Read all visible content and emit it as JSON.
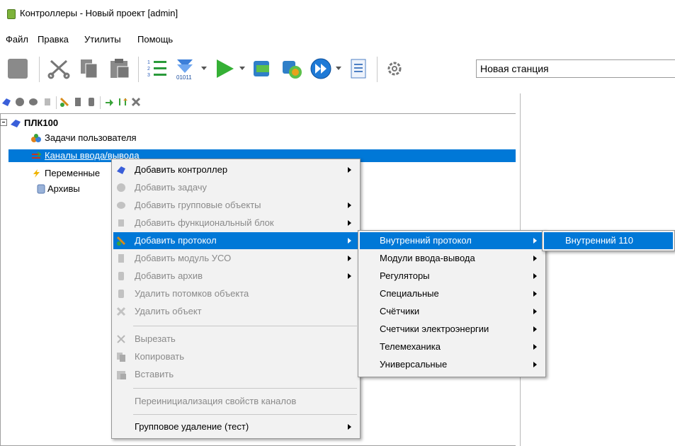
{
  "window": {
    "title": "Контроллеры - Новый проект [admin]"
  },
  "menubar": [
    "Файл",
    "Правка",
    "Утилиты",
    "Помощь"
  ],
  "toolbar": {
    "station_value": "Новая станция"
  },
  "tree": {
    "root": "ПЛК100",
    "children": [
      "Задачи пользователя",
      "Каналы ввода/вывода",
      "Переменные",
      "Архивы"
    ]
  },
  "context_menu": [
    {
      "label": "Добавить контроллер",
      "icon": "controller-icon",
      "enabled": true,
      "submenu": true
    },
    {
      "label": "Добавить задачу",
      "icon": "task-icon",
      "enabled": false,
      "submenu": false
    },
    {
      "label": "Добавить групповые объекты",
      "icon": "group-objects-icon",
      "enabled": false,
      "submenu": true
    },
    {
      "label": "Добавить функциональный блок",
      "icon": "function-block-icon",
      "enabled": false,
      "submenu": true
    },
    {
      "label": "Добавить протокол",
      "icon": "protocol-icon",
      "enabled": true,
      "submenu": true,
      "highlighted": true
    },
    {
      "label": "Добавить модуль УСО",
      "icon": "io-module-icon",
      "enabled": false,
      "submenu": true
    },
    {
      "label": "Добавить архив",
      "icon": "archive-icon",
      "enabled": false,
      "submenu": true
    },
    {
      "label": "Удалить потомков объекта",
      "icon": "delete-children-icon",
      "enabled": false,
      "submenu": false
    },
    {
      "label": "Удалить объект",
      "icon": "delete-icon",
      "enabled": false,
      "submenu": false
    },
    {
      "label": "Вырезать",
      "icon": "cut-icon",
      "enabled": false,
      "submenu": false
    },
    {
      "label": "Копировать",
      "icon": "copy-icon",
      "enabled": false,
      "submenu": false
    },
    {
      "label": "Вставить",
      "icon": "paste-icon",
      "enabled": false,
      "submenu": false
    },
    {
      "label": "Переинициализация свойств каналов",
      "icon": "",
      "enabled": false,
      "submenu": false
    },
    {
      "label": "Групповое удаление (тест)",
      "icon": "",
      "enabled": true,
      "submenu": true
    }
  ],
  "protocol_submenu": [
    {
      "label": "Внутренний протокол",
      "highlighted": true
    },
    {
      "label": "Модули ввода-вывода"
    },
    {
      "label": "Регуляторы"
    },
    {
      "label": "Специальные"
    },
    {
      "label": "Счётчики"
    },
    {
      "label": "Счетчики электроэнергии"
    },
    {
      "label": "Телемеханика"
    },
    {
      "label": "Универсальные"
    }
  ],
  "internal_submenu": [
    {
      "label": "Внутренний 110",
      "highlighted": true
    }
  ],
  "colors": {
    "selection": "#0078d7",
    "menu_bg": "#f2f2f2"
  }
}
